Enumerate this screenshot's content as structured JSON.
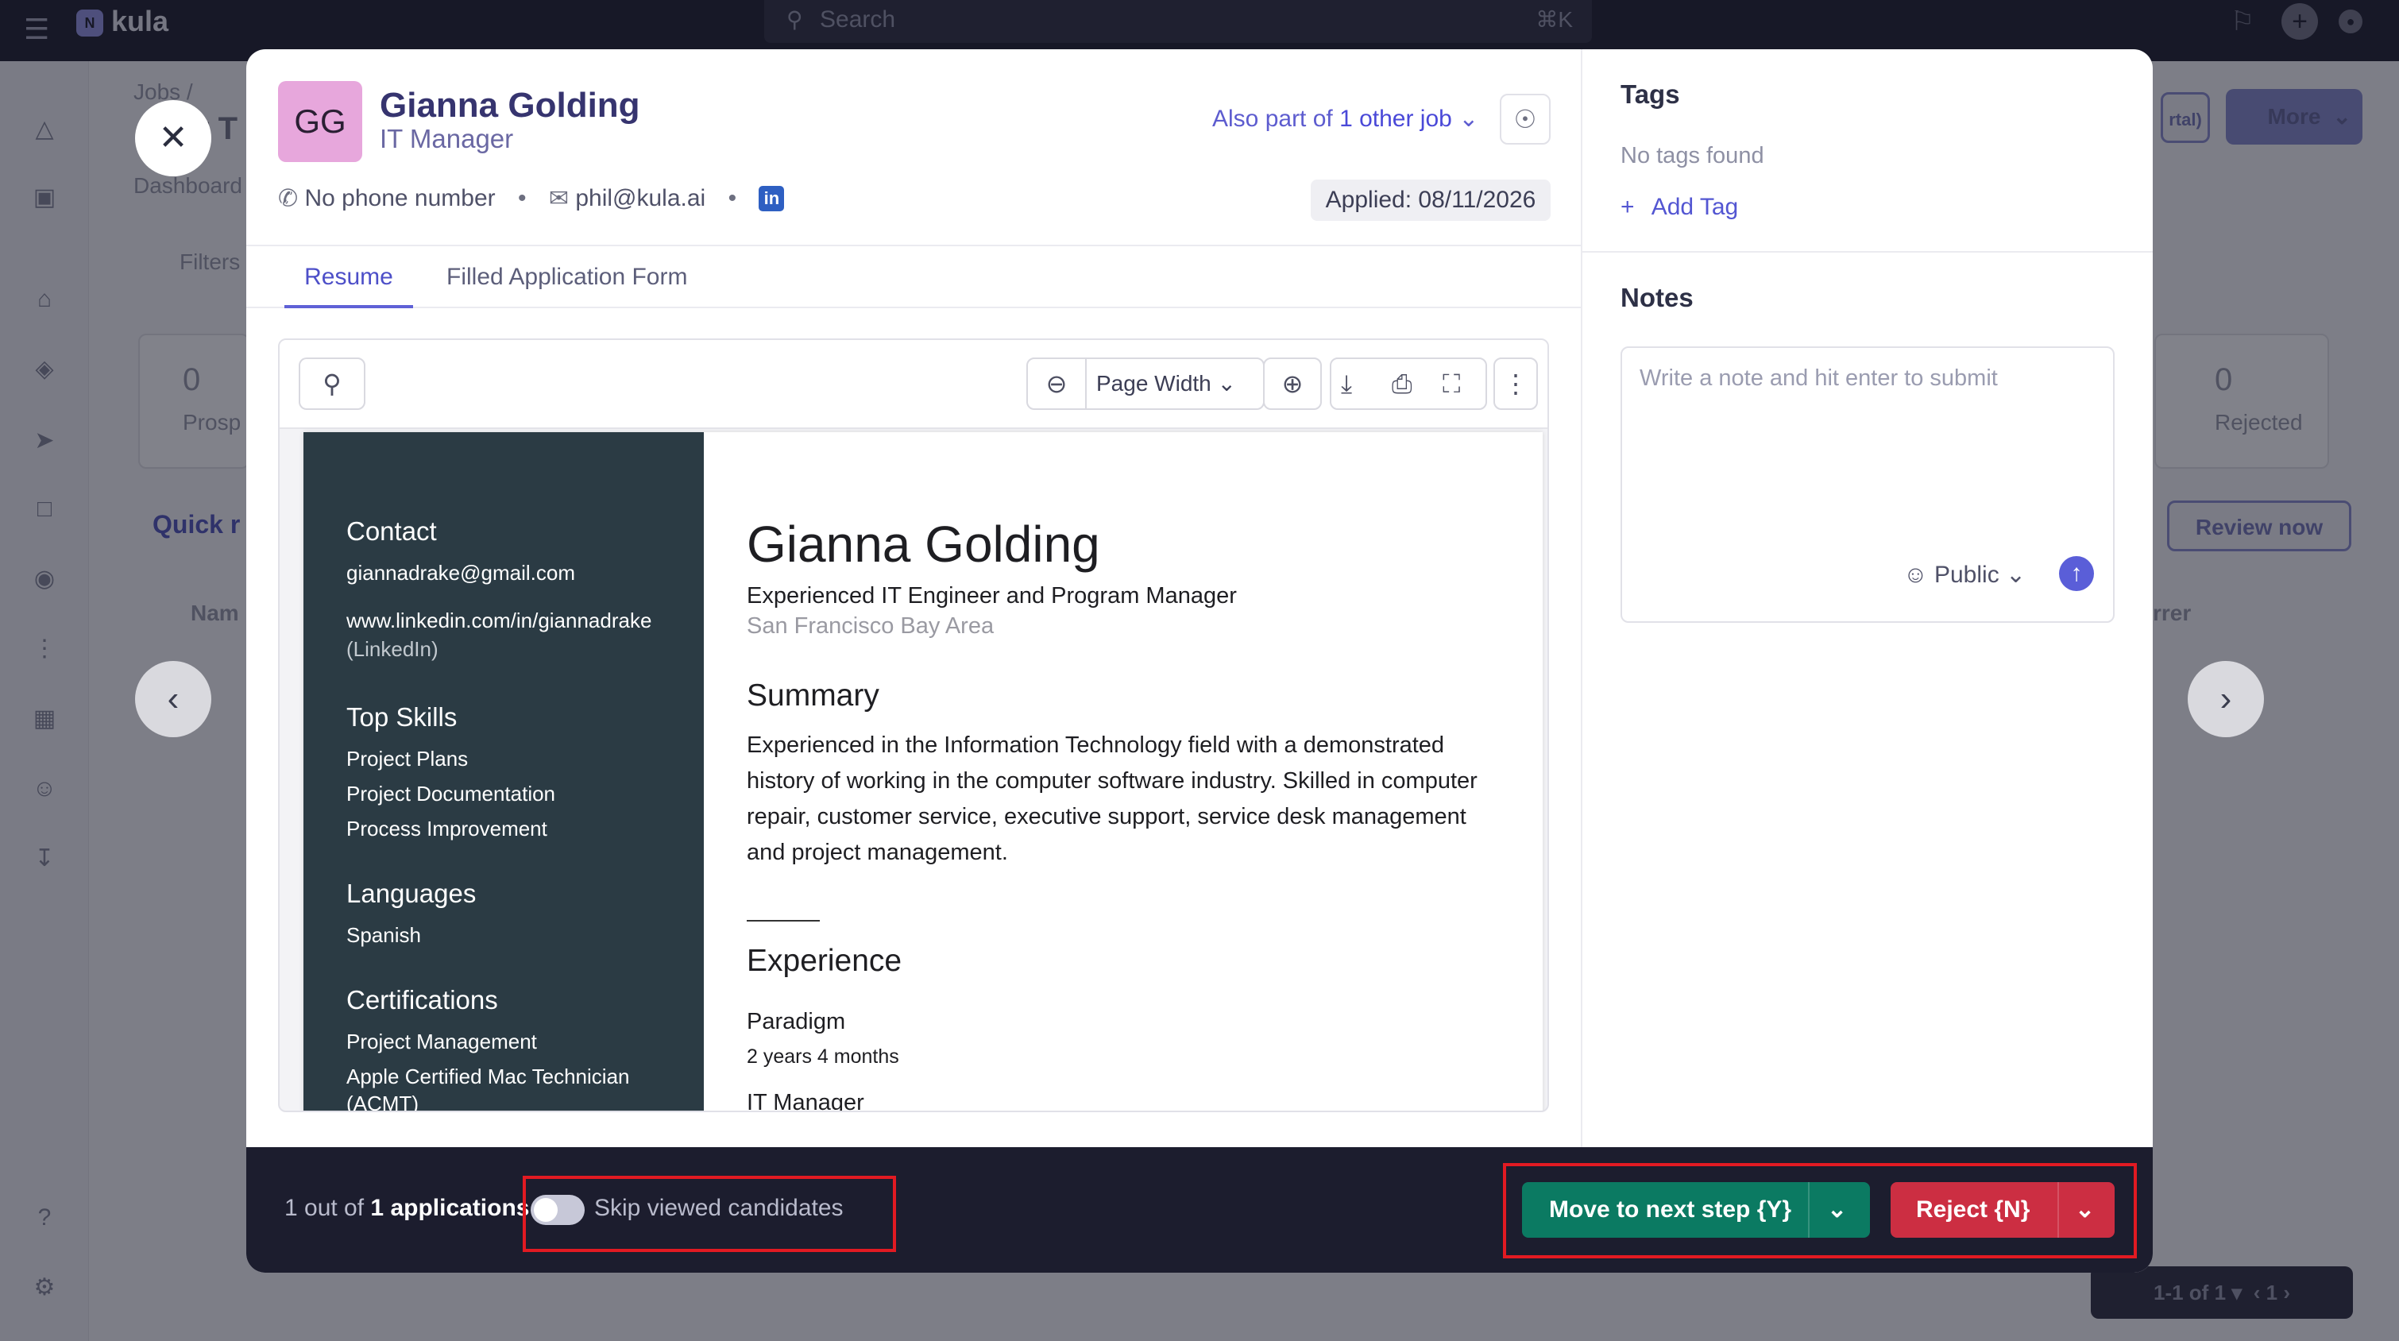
{
  "topbar": {
    "menu_icon": "menu-icon",
    "logo_mark": "N",
    "logo_text": "kula",
    "search_placeholder": "Search",
    "search_shortcut": "⌘K"
  },
  "background": {
    "breadcrumb": "Jobs /",
    "page_title_fragment": "r T",
    "dashboard_fragment": "Dashboard",
    "filters_fragment": "Filters",
    "stat_left_value": "0",
    "stat_left_label": "Prosp",
    "stat_right_value": "0",
    "stat_right_label": "Rejected",
    "quick_fragment": "Quick r",
    "review_now": "Review now",
    "name_col_fragment": "Nam",
    "referrer_col_fragment": "rrer",
    "portal_fragment": "rtal)",
    "more_label": "More",
    "pagination_label": "1-1 of 1",
    "pagination_page": "1"
  },
  "modal": {
    "candidate": {
      "initials": "GG",
      "name": "Gianna Golding",
      "role": "IT Manager",
      "phone": "No phone number",
      "email": "phil@kula.ai",
      "linkedin_badge": "in",
      "applied": "Applied: 08/11/2026",
      "also_part_prefix": "Also part of ",
      "also_part_link": "1 other job"
    },
    "tabs": [
      "Resume",
      "Filled Application Form"
    ],
    "viewer": {
      "zoom_label": "Page Width"
    },
    "resume": {
      "contact_heading": "Contact",
      "email": "giannadrake@gmail.com",
      "linkedin_url": "www.linkedin.com/in/giannadrake",
      "linkedin_note": "(LinkedIn)",
      "top_skills_heading": "Top Skills",
      "skills": [
        "Project Plans",
        "Project Documentation",
        "Process Improvement"
      ],
      "languages_heading": "Languages",
      "languages": [
        "Spanish"
      ],
      "certifications_heading": "Certifications",
      "certifications": [
        "Project Management",
        "Apple Certified Mac Technician",
        "(ACMT)"
      ],
      "name": "Gianna Golding",
      "headline": "Experienced IT Engineer and Program Manager",
      "location": "San Francisco Bay Area",
      "summary_heading": "Summary",
      "summary": "Experienced in the Information Technology field with a demonstrated history of working in the computer software industry. Skilled in computer repair, customer service, executive support, service desk management and project management.",
      "experience_heading": "Experience",
      "company": "Paradigm",
      "duration": "2 years 4 months",
      "job_title": "IT Manager"
    },
    "tags": {
      "title": "Tags",
      "empty": "No tags found",
      "add": "Add Tag"
    },
    "notes": {
      "title": "Notes",
      "placeholder": "Write a note and hit enter to submit",
      "visibility": "Public"
    },
    "footer": {
      "count_prefix": "1 out of ",
      "count_bold": "1 applications",
      "skip_label": "Skip viewed candidates",
      "skip_enabled": false,
      "move_button": "Move to next step {Y}",
      "reject_button": "Reject {N}"
    }
  },
  "colors": {
    "primary": "#5356d2",
    "move": "#0b7a62",
    "reject": "#cc2e42",
    "footer_bg": "#1c1d2e",
    "highlight": "#e21a22"
  }
}
